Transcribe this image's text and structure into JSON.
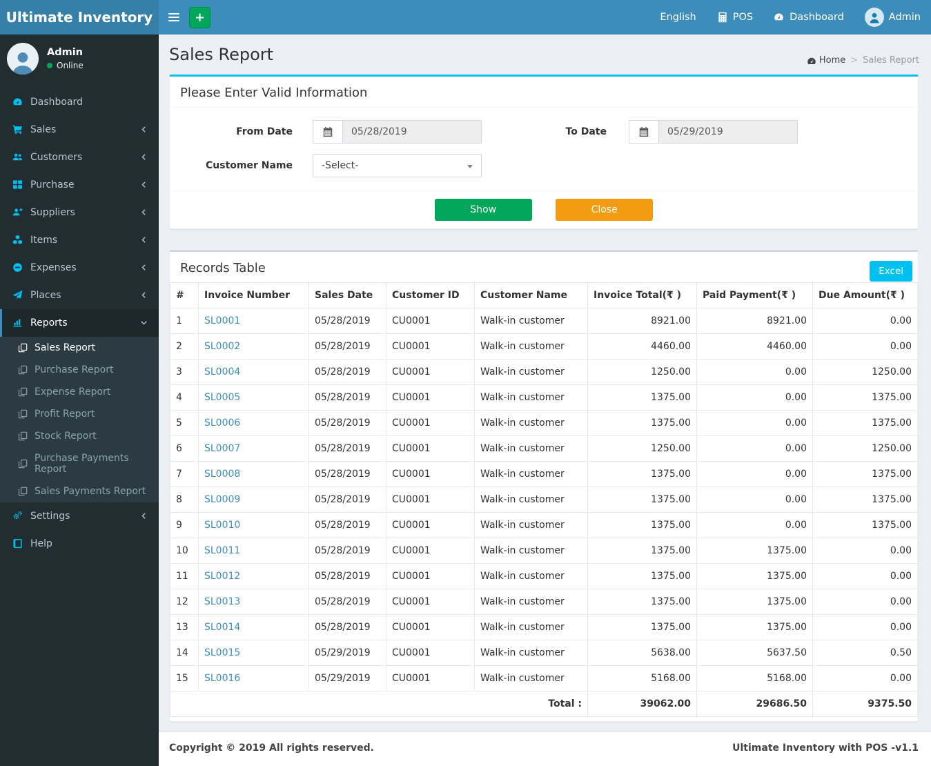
{
  "navbar": {
    "brand": "Ultimate Inventory",
    "plus_label": "+",
    "items": [
      {
        "label": "English",
        "icon": null,
        "name": "nav-item-english"
      },
      {
        "label": "POS",
        "icon": "calculator",
        "name": "nav-item-pos"
      },
      {
        "label": "Dashboard",
        "icon": "gauge",
        "name": "nav-item-dashboard"
      },
      {
        "label": "Admin",
        "icon": "avatar",
        "name": "nav-item-admin"
      }
    ]
  },
  "sidebar": {
    "user": {
      "name": "Admin",
      "status": "Online"
    },
    "items": [
      {
        "label": "Dashboard",
        "icon": "gauge",
        "chevron": null,
        "active": false
      },
      {
        "label": "Sales",
        "icon": "cart",
        "chevron": "left",
        "active": false
      },
      {
        "label": "Customers",
        "icon": "users",
        "chevron": "left",
        "active": false
      },
      {
        "label": "Purchase",
        "icon": "grid",
        "chevron": "left",
        "active": false
      },
      {
        "label": "Suppliers",
        "icon": "user-plus",
        "chevron": "left",
        "active": false
      },
      {
        "label": "Items",
        "icon": "cubes",
        "chevron": "left",
        "active": false
      },
      {
        "label": "Expenses",
        "icon": "minus-circle",
        "chevron": "left",
        "active": false
      },
      {
        "label": "Places",
        "icon": "paper-plane",
        "chevron": "left",
        "active": false
      },
      {
        "label": "Reports",
        "icon": "bar-chart",
        "chevron": "down",
        "active": true,
        "submenu": [
          {
            "label": "Sales Report",
            "icon": "copy",
            "active": true
          },
          {
            "label": "Purchase Report",
            "icon": "copy",
            "active": false
          },
          {
            "label": "Expense Report",
            "icon": "copy",
            "active": false
          },
          {
            "label": "Profit Report",
            "icon": "copy",
            "active": false
          },
          {
            "label": "Stock Report",
            "icon": "copy",
            "active": false
          },
          {
            "label": "Purchase Payments Report",
            "icon": "copy",
            "active": false
          },
          {
            "label": "Sales Payments Report",
            "icon": "copy",
            "active": false
          }
        ]
      },
      {
        "label": "Settings",
        "icon": "gears",
        "chevron": "left",
        "active": false
      },
      {
        "label": "Help",
        "icon": "book",
        "chevron": null,
        "active": false
      }
    ]
  },
  "page": {
    "title": "Sales Report",
    "breadcrumb_home": "Home",
    "breadcrumb_sep": ">",
    "breadcrumb_current": "Sales Report"
  },
  "filter": {
    "title": "Please Enter Valid Information",
    "from_date": {
      "label": "From Date",
      "value": "05/28/2019"
    },
    "to_date": {
      "label": "To Date",
      "value": "05/29/2019"
    },
    "customer": {
      "label": "Customer Name",
      "value": "-Select-"
    },
    "show_label": "Show",
    "close_label": "Close"
  },
  "records": {
    "title": "Records Table",
    "excel_label": "Excel",
    "columns": [
      "#",
      "Invoice Number",
      "Sales Date",
      "Customer ID",
      "Customer Name",
      "Invoice Total(₹ )",
      "Paid Payment(₹ )",
      "Due Amount(₹ )"
    ],
    "rows": [
      [
        "1",
        "SL0001",
        "05/28/2019",
        "CU0001",
        "Walk-in customer",
        "8921.00",
        "8921.00",
        "0.00"
      ],
      [
        "2",
        "SL0002",
        "05/28/2019",
        "CU0001",
        "Walk-in customer",
        "4460.00",
        "4460.00",
        "0.00"
      ],
      [
        "3",
        "SL0004",
        "05/28/2019",
        "CU0001",
        "Walk-in customer",
        "1250.00",
        "0.00",
        "1250.00"
      ],
      [
        "4",
        "SL0005",
        "05/28/2019",
        "CU0001",
        "Walk-in customer",
        "1375.00",
        "0.00",
        "1375.00"
      ],
      [
        "5",
        "SL0006",
        "05/28/2019",
        "CU0001",
        "Walk-in customer",
        "1375.00",
        "0.00",
        "1375.00"
      ],
      [
        "6",
        "SL0007",
        "05/28/2019",
        "CU0001",
        "Walk-in customer",
        "1250.00",
        "0.00",
        "1250.00"
      ],
      [
        "7",
        "SL0008",
        "05/28/2019",
        "CU0001",
        "Walk-in customer",
        "1375.00",
        "0.00",
        "1375.00"
      ],
      [
        "8",
        "SL0009",
        "05/28/2019",
        "CU0001",
        "Walk-in customer",
        "1375.00",
        "0.00",
        "1375.00"
      ],
      [
        "9",
        "SL0010",
        "05/28/2019",
        "CU0001",
        "Walk-in customer",
        "1375.00",
        "0.00",
        "1375.00"
      ],
      [
        "10",
        "SL0011",
        "05/28/2019",
        "CU0001",
        "Walk-in customer",
        "1375.00",
        "1375.00",
        "0.00"
      ],
      [
        "11",
        "SL0012",
        "05/28/2019",
        "CU0001",
        "Walk-in customer",
        "1375.00",
        "1375.00",
        "0.00"
      ],
      [
        "12",
        "SL0013",
        "05/28/2019",
        "CU0001",
        "Walk-in customer",
        "1375.00",
        "1375.00",
        "0.00"
      ],
      [
        "13",
        "SL0014",
        "05/28/2019",
        "CU0001",
        "Walk-in customer",
        "1375.00",
        "1375.00",
        "0.00"
      ],
      [
        "14",
        "SL0015",
        "05/29/2019",
        "CU0001",
        "Walk-in customer",
        "5638.00",
        "5637.50",
        "0.50"
      ],
      [
        "15",
        "SL0016",
        "05/29/2019",
        "CU0001",
        "Walk-in customer",
        "5168.00",
        "5168.00",
        "0.00"
      ]
    ],
    "total_label": "Total :",
    "totals": [
      "39062.00",
      "29686.50",
      "9375.50"
    ]
  },
  "footer": {
    "left": "Copyright © 2019 All rights reserved.",
    "right": "Ultimate Inventory with POS -v1.1"
  },
  "colors": {
    "navbar": "#3c8dbc",
    "logo_bg": "#367fa9",
    "sidebar_bg": "#222d32",
    "submenu_bg": "#2c3b41",
    "icon_cyan": "#00c0ef",
    "green": "#00a65a",
    "orange": "#f39c12",
    "link": "#3c8dbc",
    "content_bg": "#ecf0f5"
  }
}
